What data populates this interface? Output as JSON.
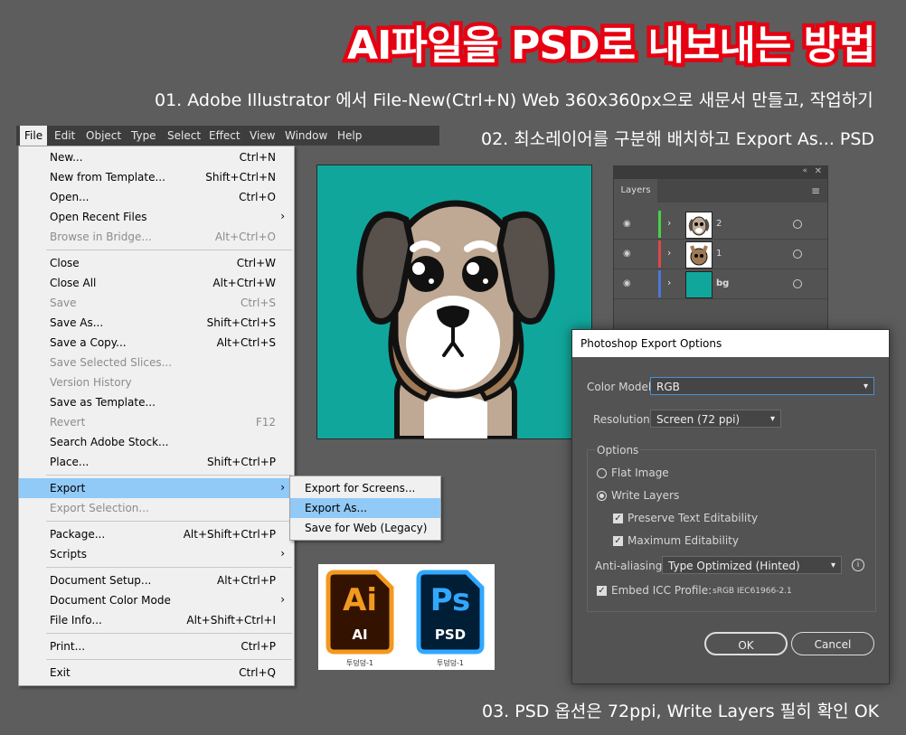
{
  "title": "AI파일을 PSD로 내보내는 방법",
  "steps": {
    "step1": "01. Adobe Illustrator 에서 File-New(Ctrl+N)  Web 360x360px으로 새문서 만들고, 작업하기",
    "step2": "02. 최소레이어를 구분해 배치하고 Export As... PSD",
    "step3": "03. PSD 옵션은 72ppi, Write Layers 필히 확인 OK"
  },
  "menubar": [
    "File",
    "Edit",
    "Object",
    "Type",
    "Select",
    "Effect",
    "View",
    "Window",
    "Help"
  ],
  "file_menu": [
    {
      "label": "New...",
      "shortcut": "Ctrl+N"
    },
    {
      "label": "New from Template...",
      "shortcut": "Shift+Ctrl+N"
    },
    {
      "label": "Open...",
      "shortcut": "Ctrl+O"
    },
    {
      "label": "Open Recent Files",
      "shortcut": ""
    },
    {
      "label": "Browse in Bridge...",
      "shortcut": "Alt+Ctrl+O"
    },
    {
      "label": "Close",
      "shortcut": "Ctrl+W"
    },
    {
      "label": "Close All",
      "shortcut": "Alt+Ctrl+W"
    },
    {
      "label": "Save",
      "shortcut": "Ctrl+S"
    },
    {
      "label": "Save As...",
      "shortcut": "Shift+Ctrl+S"
    },
    {
      "label": "Save a Copy...",
      "shortcut": "Alt+Ctrl+S"
    },
    {
      "label": "Save Selected Slices...",
      "shortcut": ""
    },
    {
      "label": "Version History",
      "shortcut": ""
    },
    {
      "label": "Save as Template...",
      "shortcut": ""
    },
    {
      "label": "Revert",
      "shortcut": "F12"
    },
    {
      "label": "Search Adobe Stock...",
      "shortcut": ""
    },
    {
      "label": "Place...",
      "shortcut": "Shift+Ctrl+P"
    },
    {
      "label": "Export",
      "shortcut": ""
    },
    {
      "label": "Export Selection...",
      "shortcut": ""
    },
    {
      "label": "Package...",
      "shortcut": "Alt+Shift+Ctrl+P"
    },
    {
      "label": "Scripts",
      "shortcut": ""
    },
    {
      "label": "Document Setup...",
      "shortcut": "Alt+Ctrl+P"
    },
    {
      "label": "Document Color Mode",
      "shortcut": ""
    },
    {
      "label": "File Info...",
      "shortcut": "Alt+Shift+Ctrl+I"
    },
    {
      "label": "Print...",
      "shortcut": "Ctrl+P"
    },
    {
      "label": "Exit",
      "shortcut": "Ctrl+Q"
    }
  ],
  "export_submenu": [
    "Export for Screens...",
    "Export As...",
    "Save for Web (Legacy)"
  ],
  "layers_panel": {
    "tab": "Layers",
    "layers": [
      {
        "name": "2",
        "color": "#46d246"
      },
      {
        "name": "1",
        "color": "#e0464b"
      },
      {
        "name": "bg",
        "color": "#4a78d8"
      }
    ]
  },
  "export_dialog": {
    "title": "Photoshop Export Options",
    "color_model_label": "Color Model:",
    "color_model_value": "RGB",
    "resolution_label": "Resolution:",
    "resolution_value": "Screen (72 ppi)",
    "options_label": "Options",
    "flat_image": "Flat Image",
    "write_layers": "Write Layers",
    "preserve_text": "Preserve Text Editability",
    "max_edit": "Maximum Editability",
    "antialias_label": "Anti-aliasing:",
    "antialias_value": "Type Optimized (Hinted)",
    "icc_label": "Embed ICC Profile:",
    "icc_value": "sRGB IEC61966-2.1",
    "ok": "OK",
    "cancel": "Cancel"
  },
  "logos": {
    "ai_big": "Ai",
    "ai_small": "AI",
    "ps_big": "Ps",
    "ps_small": "PSD",
    "caption1": "투덩덩-1",
    "caption2": "투덩덩-1"
  },
  "colors": {
    "title_red": "#e60012",
    "artboard_teal": "#11a69b",
    "menu_highlight": "#91c9f7",
    "ai_orange": "#f29a1f",
    "ai_dark": "#331300",
    "ps_blue": "#31a8ff",
    "ps_dark": "#001e36"
  }
}
